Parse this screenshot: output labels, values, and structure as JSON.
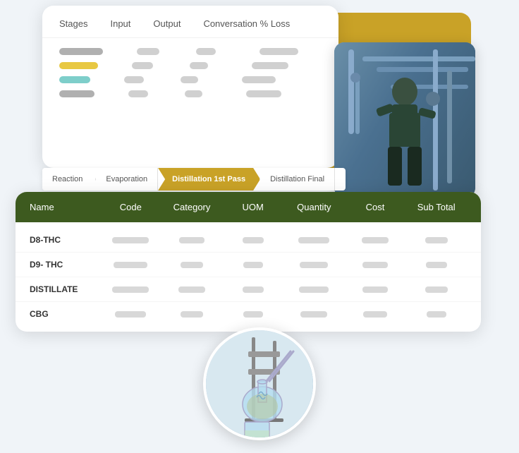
{
  "scene": {
    "background": "#f0f4f8"
  },
  "top_card": {
    "headers": [
      "Stages",
      "Input",
      "Output",
      "Conversation % Loss"
    ],
    "rows": [
      {
        "name_width": 60,
        "col2_width": 30,
        "col3_width": 28,
        "col4_width": 55,
        "color": "default"
      },
      {
        "name_width": 55,
        "col2_width": 30,
        "col3_width": 28,
        "col4_width": 55,
        "color": "yellow"
      },
      {
        "name_width": 45,
        "col2_width": 30,
        "col3_width": 28,
        "col4_width": 55,
        "color": "teal"
      },
      {
        "name_width": 50,
        "col2_width": 30,
        "col3_width": 28,
        "col4_width": 55,
        "color": "default"
      }
    ]
  },
  "process_steps": [
    {
      "label": "Reaction",
      "active": false,
      "first": true
    },
    {
      "label": "Evaporation",
      "active": false,
      "first": false
    },
    {
      "label": "Distillation 1st Pass",
      "active": true,
      "first": false
    },
    {
      "label": "Distillation Final",
      "active": false,
      "first": false
    }
  ],
  "main_table": {
    "headers": [
      "Name",
      "Code",
      "Category",
      "UOM",
      "Quantity",
      "Cost",
      "Sub Total"
    ],
    "rows": [
      {
        "name": "D8-THC"
      },
      {
        "name": "D9- THC"
      },
      {
        "name": "DISTILLATE"
      },
      {
        "name": "CBG"
      }
    ]
  }
}
